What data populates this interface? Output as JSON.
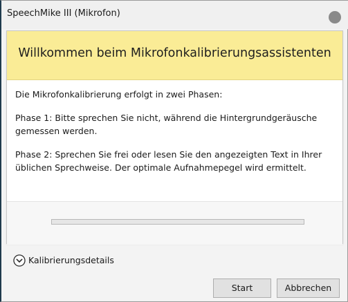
{
  "window": {
    "title": "SpeechMike III (Mikrofon)"
  },
  "banner": {
    "title": "Willkommen beim Mikrofonkalibrierungsassistenten"
  },
  "content": {
    "intro": "Die Mikrofonkalibrierung erfolgt in zwei Phasen:",
    "phase1": "Phase 1: Bitte sprechen Sie nicht, während die Hintergrundgeräusche gemessen werden.",
    "phase2": "Phase 2: Sprechen Sie frei oder lesen Sie den angezeigten Text in Ihrer üblichen Sprechweise. Der optimale Aufnahmepegel wird ermittelt."
  },
  "progress": {
    "value": 0
  },
  "details": {
    "label": "Kalibrierungsdetails",
    "icon": "chevron-down-circle-icon"
  },
  "buttons": {
    "start": "Start",
    "cancel": "Abbrechen"
  },
  "colors": {
    "banner": "#faec96",
    "window_bg": "#f3f3f3",
    "title_circle": "#8a8a8a"
  }
}
